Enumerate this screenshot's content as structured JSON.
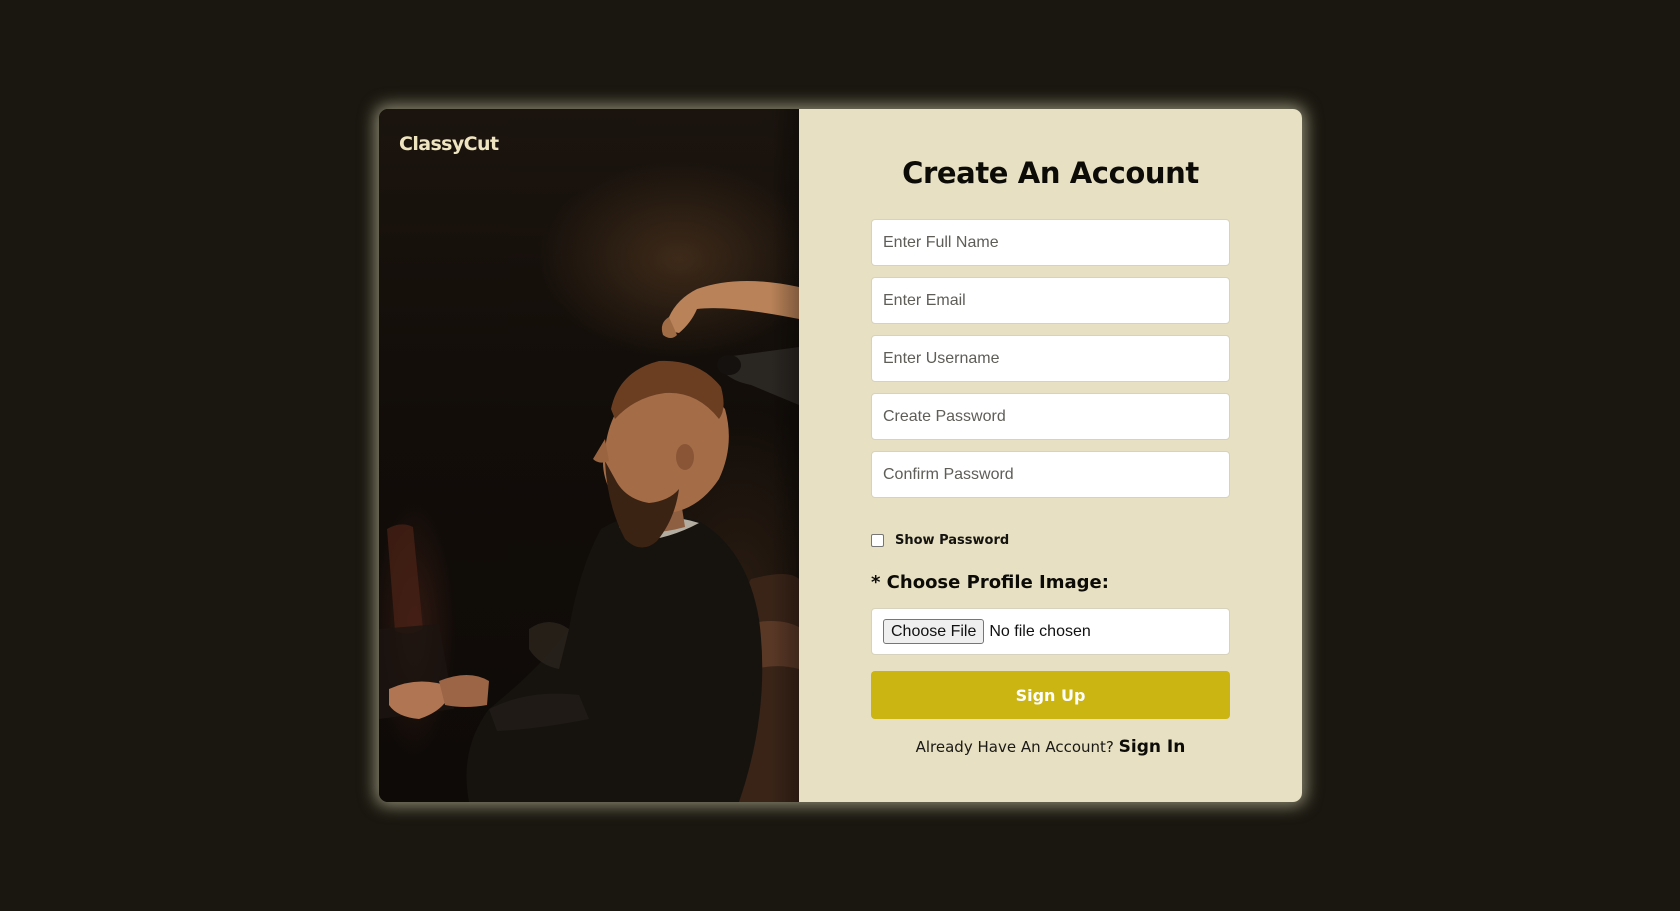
{
  "brand": {
    "logo_text": "ClassyCut"
  },
  "form": {
    "title": "Create An Account",
    "fields": [
      {
        "name": "full-name",
        "placeholder": "Enter Full Name",
        "value": ""
      },
      {
        "name": "email",
        "placeholder": "Enter Email",
        "value": ""
      },
      {
        "name": "username",
        "placeholder": "Enter Username",
        "value": ""
      },
      {
        "name": "create-password",
        "placeholder": "Create Password",
        "value": ""
      },
      {
        "name": "confirm-password",
        "placeholder": "Confirm Password",
        "value": ""
      }
    ],
    "show_password": {
      "label": "Show Password",
      "checked": false
    },
    "profile_image": {
      "label": "* Choose Profile Image:",
      "button_label": "Choose File",
      "status": "No file chosen"
    },
    "submit_label": "Sign Up",
    "signin_prompt": "Already Have An Account?",
    "signin_link": "Sign In"
  },
  "colors": {
    "page_background": "#19170f",
    "form_panel": "#e7e0c2",
    "accent_button": "#cbb513",
    "logo": "#efe4c0"
  },
  "image": {
    "subject": "barber-photo"
  }
}
